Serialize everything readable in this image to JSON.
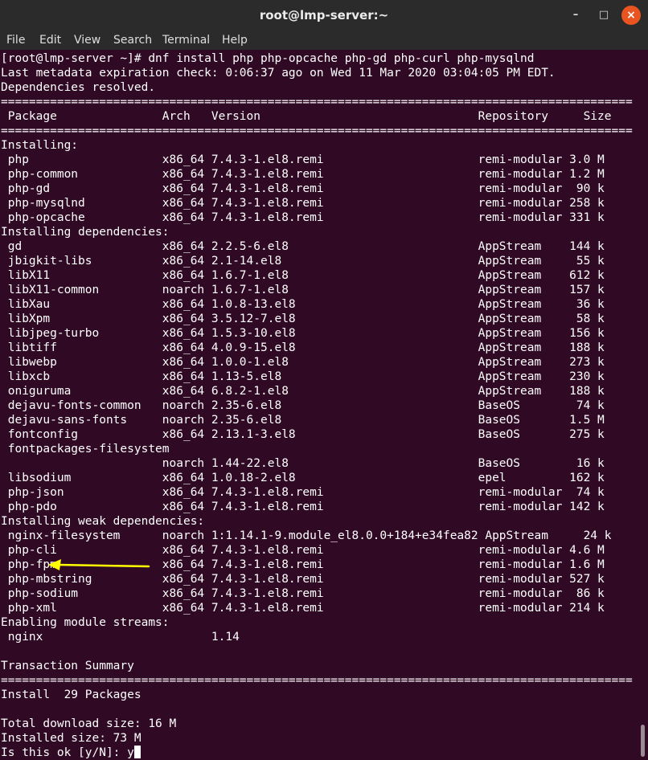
{
  "window": {
    "title": "root@lmp-server:~",
    "controls": [
      "–",
      "□",
      "×"
    ]
  },
  "menubar": [
    "File",
    "Edit",
    "View",
    "Search",
    "Terminal",
    "Help"
  ],
  "terminal": {
    "lines": [
      "[root@lmp-server ~]# dnf install php php-opcache php-gd php-curl php-mysqlnd",
      "Last metadata expiration check: 0:06:37 ago on Wed 11 Mar 2020 03:04:05 PM EDT.",
      "Dependencies resolved.",
      "==========================================================================================",
      " Package               Arch   Version                               Repository     Size",
      "==========================================================================================",
      "Installing:",
      " php                   x86_64 7.4.3-1.el8.remi                      remi-modular 3.0 M",
      " php-common            x86_64 7.4.3-1.el8.remi                      remi-modular 1.2 M",
      " php-gd                x86_64 7.4.3-1.el8.remi                      remi-modular  90 k",
      " php-mysqlnd           x86_64 7.4.3-1.el8.remi                      remi-modular 258 k",
      " php-opcache           x86_64 7.4.3-1.el8.remi                      remi-modular 331 k",
      "Installing dependencies:",
      " gd                    x86_64 2.2.5-6.el8                           AppStream    144 k",
      " jbigkit-libs          x86_64 2.1-14.el8                            AppStream     55 k",
      " libX11                x86_64 1.6.7-1.el8                           AppStream    612 k",
      " libX11-common         noarch 1.6.7-1.el8                           AppStream    157 k",
      " libXau                x86_64 1.0.8-13.el8                          AppStream     36 k",
      " libXpm                x86_64 3.5.12-7.el8                          AppStream     58 k",
      " libjpeg-turbo         x86_64 1.5.3-10.el8                          AppStream    156 k",
      " libtiff               x86_64 4.0.9-15.el8                          AppStream    188 k",
      " libwebp               x86_64 1.0.0-1.el8                           AppStream    273 k",
      " libxcb                x86_64 1.13-5.el8                            AppStream    230 k",
      " oniguruma             x86_64 6.8.2-1.el8                           AppStream    188 k",
      " dejavu-fonts-common   noarch 2.35-6.el8                            BaseOS        74 k",
      " dejavu-sans-fonts     noarch 2.35-6.el8                            BaseOS       1.5 M",
      " fontconfig            x86_64 2.13.1-3.el8                          BaseOS       275 k",
      " fontpackages-filesystem",
      "                       noarch 1.44-22.el8                           BaseOS        16 k",
      " libsodium             x86_64 1.0.18-2.el8                          epel         162 k",
      " php-json              x86_64 7.4.3-1.el8.remi                      remi-modular  74 k",
      " php-pdo               x86_64 7.4.3-1.el8.remi                      remi-modular 142 k",
      "Installing weak dependencies:",
      " nginx-filesystem      noarch 1:1.14.1-9.module_el8.0.0+184+e34fea82 AppStream     24 k",
      " php-cli               x86_64 7.4.3-1.el8.remi                      remi-modular 4.6 M",
      " php-fpm               x86_64 7.4.3-1.el8.remi                      remi-modular 1.6 M",
      " php-mbstring          x86_64 7.4.3-1.el8.remi                      remi-modular 527 k",
      " php-sodium            x86_64 7.4.3-1.el8.remi                      remi-modular  86 k",
      " php-xml               x86_64 7.4.3-1.el8.remi                      remi-modular 214 k",
      "Enabling module streams:",
      " nginx                        1.14",
      "",
      "Transaction Summary",
      "==========================================================================================",
      "Install  29 Packages",
      "",
      "Total download size: 16 M",
      "Installed size: 73 M"
    ],
    "prompt": "Is this ok [y/N]: ",
    "input_value": "y"
  },
  "colors": {
    "background": "#300a24",
    "titlebar": "#2b2b2b",
    "text": "#ffffff",
    "close_button": "#e95420",
    "arrow": "#ffff00"
  }
}
